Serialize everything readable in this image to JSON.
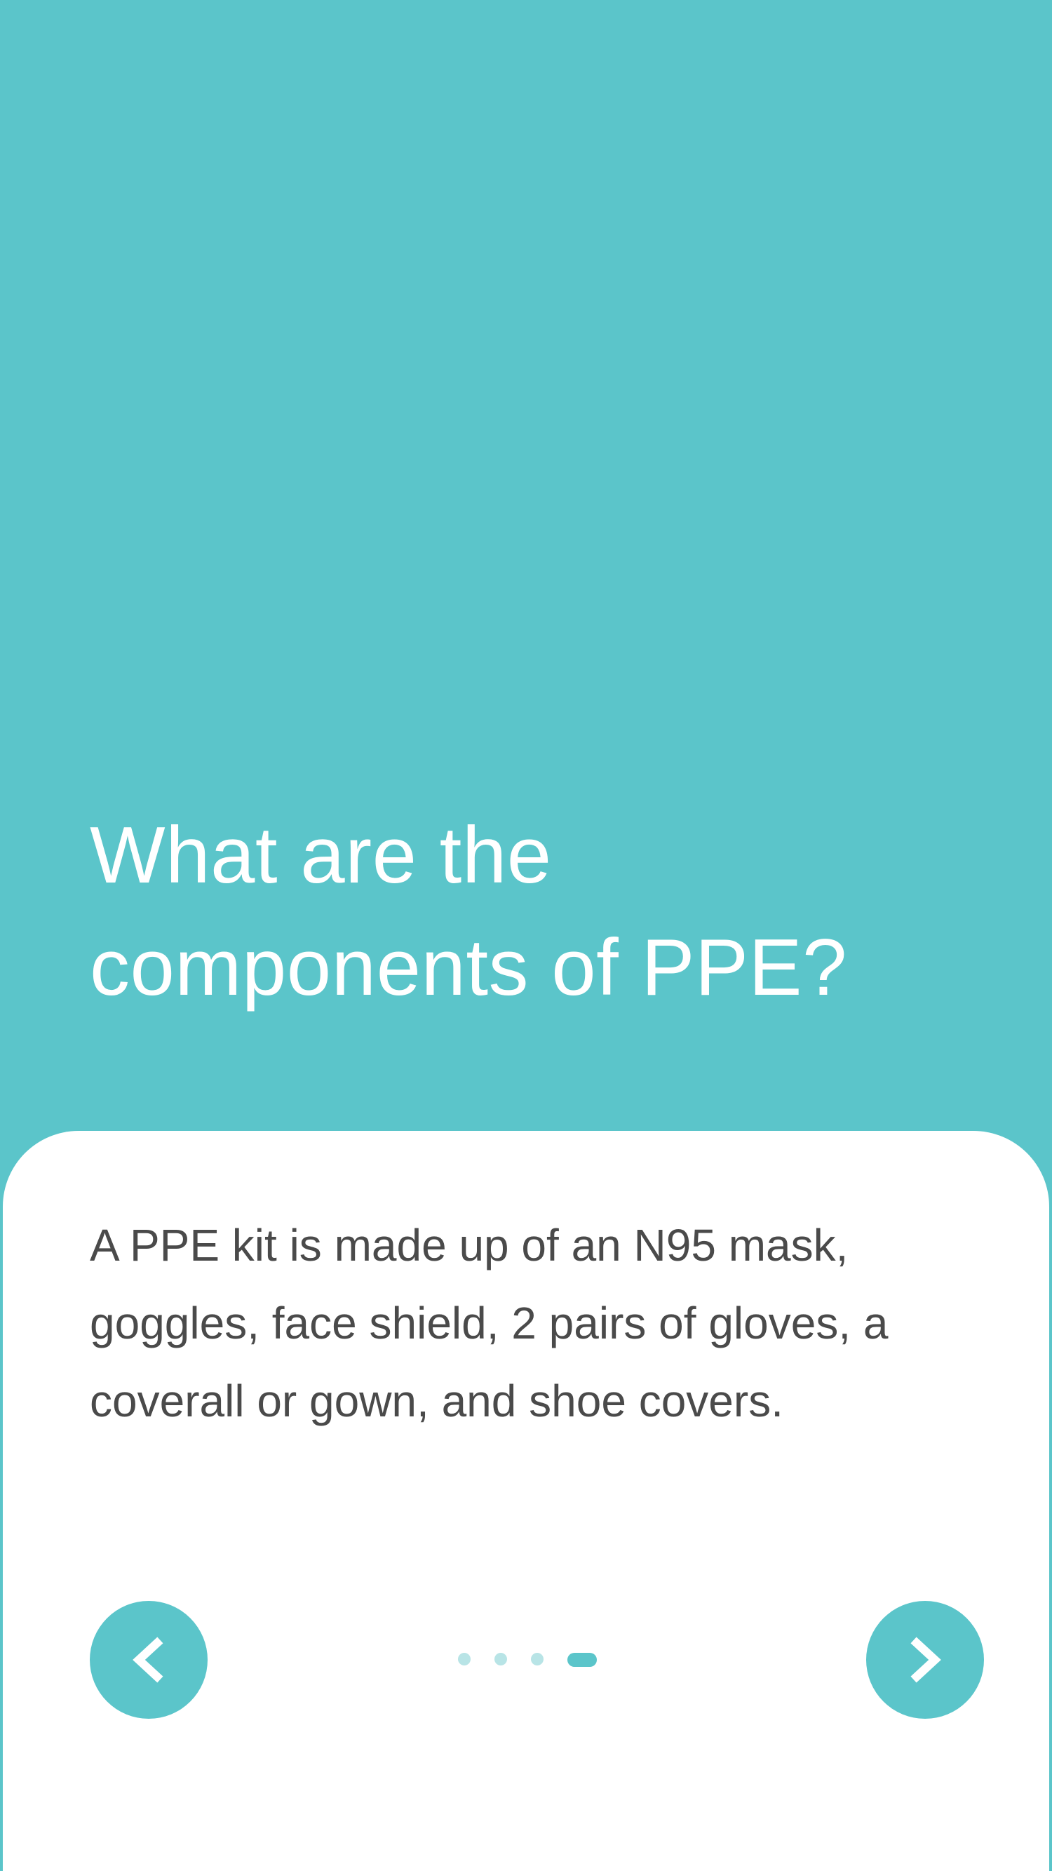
{
  "colors": {
    "accent": "#5BC5CA",
    "accent_light": "#B8E4E6",
    "surface": "#FFFFFF",
    "body_text": "#4A4A4A",
    "title_text": "#FFFFFF"
  },
  "hero": {
    "title_line1": "What are the",
    "title_line2": "components of PPE?"
  },
  "card": {
    "body": "A PPE kit is made up of an N95 mask, goggles, face shield, 2 pairs of gloves, a coverall or gown, and shoe covers."
  },
  "navigation": {
    "prev_icon": "chevron-left-icon",
    "next_icon": "chevron-right-icon",
    "page_count": 4,
    "current_page": 4
  }
}
